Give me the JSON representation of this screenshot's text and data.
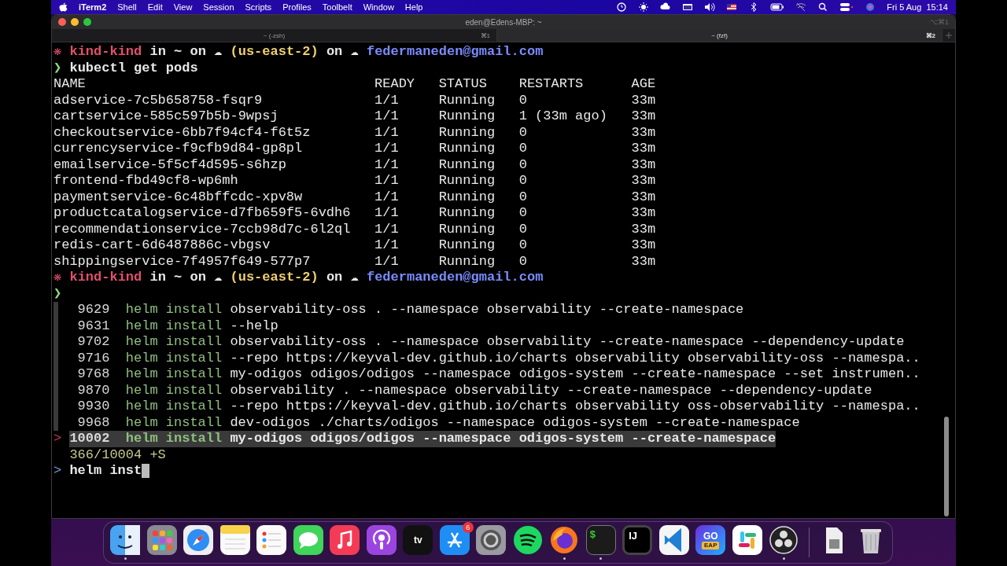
{
  "menu_bar": {
    "app": "iTerm2",
    "menus": [
      "Shell",
      "Edit",
      "View",
      "Session",
      "Scripts",
      "Profiles",
      "Toolbelt",
      "Window",
      "Help"
    ],
    "clock": "Fri 5 Aug  15:14"
  },
  "window": {
    "title": "eden@Edens-MBP: ~",
    "shortcut": "⌥⌘1",
    "tabs": [
      {
        "label": "~ (-zsh)",
        "shortcut": "⌘1",
        "selected": false
      },
      {
        "label": "~ (fzf)",
        "shortcut": "⌘2",
        "selected": true
      }
    ]
  },
  "terminal": {
    "lines": [
      {
        "kind": "prompt",
        "marker": "❋",
        "context": "kind-kind",
        "before": "in ~ on ☁",
        "region": "(us-east-2)",
        "after": "on ☁",
        "account": "federmaneden@gmail.com"
      },
      {
        "kind": "command",
        "arrow": "❯",
        "text": "kubectl get pods"
      },
      {
        "kind": "table",
        "columns": [
          "NAME",
          "READY",
          "STATUS",
          "RESTARTS",
          "AGE"
        ],
        "rows": [
          [
            "adservice-7c5b658758-fsqr9",
            "1/1",
            "Running",
            "0",
            "33m"
          ],
          [
            "cartservice-585c597b5b-9wpsj",
            "1/1",
            "Running",
            "1 (33m ago)",
            "33m"
          ],
          [
            "checkoutservice-6bb7f94cf4-f6t5z",
            "1/1",
            "Running",
            "0",
            "33m"
          ],
          [
            "currencyservice-f9cfb9d84-gp8pl",
            "1/1",
            "Running",
            "0",
            "33m"
          ],
          [
            "emailservice-5f5cf4d595-s6hzp",
            "1/1",
            "Running",
            "0",
            "33m"
          ],
          [
            "frontend-fbd49cf8-wp6mh",
            "1/1",
            "Running",
            "0",
            "33m"
          ],
          [
            "paymentservice-6c48bffcdc-xpv8w",
            "1/1",
            "Running",
            "0",
            "33m"
          ],
          [
            "productcatalogservice-d7fb659f5-6vdh6",
            "1/1",
            "Running",
            "0",
            "33m"
          ],
          [
            "recommendationservice-7ccb98d7c-6l2ql",
            "1/1",
            "Running",
            "0",
            "33m"
          ],
          [
            "redis-cart-6d6487886c-vbgsv",
            "1/1",
            "Running",
            "0",
            "33m"
          ],
          [
            "shippingservice-7f4957f649-577p7",
            "1/1",
            "Running",
            "0",
            "33m"
          ]
        ]
      },
      {
        "kind": "prompt",
        "marker": "❋",
        "context": "kind-kind",
        "before": "in ~ on ☁",
        "region": "(us-east-2)",
        "after": "on ☁",
        "account": "federmaneden@gmail.com"
      },
      {
        "kind": "command",
        "arrow": "❯"
      }
    ],
    "history": {
      "marker": ">",
      "items": [
        {
          "number": "9629",
          "command": "helm install",
          "args": "observability-oss . --namespace observability --create-namespace",
          "selected": false
        },
        {
          "number": "9631",
          "command": "helm install",
          "args": "--help",
          "selected": false
        },
        {
          "number": "9702",
          "command": "helm install",
          "args": "observability-oss . --namespace observability --create-namespace --dependency-update",
          "selected": false
        },
        {
          "number": "9716",
          "command": "helm install",
          "args": "--repo https://keyval-dev.github.io/charts observability observability-oss --namespa..",
          "selected": false
        },
        {
          "number": "9768",
          "command": "helm install",
          "args": "my-odigos odigos/odigos --namespace odigos-system --create-namespace --set instrumen..",
          "selected": false
        },
        {
          "number": "9870",
          "command": "helm install",
          "args": "observability . --namespace observability --create-namespace --dependency-update",
          "selected": false
        },
        {
          "number": "9930",
          "command": "helm install",
          "args": "--repo https://keyval-dev.github.io/charts observability oss-observability --namespa..",
          "selected": false
        },
        {
          "number": "9968",
          "command": "helm install",
          "args": "dev-odigos ./charts/odigos --namespace odigos-system --create-namespace",
          "selected": false
        },
        {
          "number": "10002",
          "command": "helm install",
          "args": "my-odigos odigos/odigos --namespace odigos-system --create-namespace",
          "selected": true
        }
      ],
      "count": "366/10004 +S",
      "prompt": ">",
      "query": "helm inst"
    }
  },
  "dock": {
    "items": [
      {
        "kind": "finder",
        "running": true
      },
      {
        "kind": "launchpad",
        "running": false
      },
      {
        "kind": "safari",
        "running": false
      },
      {
        "kind": "notes",
        "running": false
      },
      {
        "kind": "reminders",
        "running": false
      },
      {
        "kind": "messages",
        "running": false
      },
      {
        "kind": "music",
        "running": false
      },
      {
        "kind": "podcasts",
        "running": false
      },
      {
        "kind": "tv",
        "running": false,
        "label": "tv"
      },
      {
        "kind": "appstore",
        "running": false,
        "badge": "6"
      },
      {
        "kind": "settings",
        "running": false
      },
      {
        "kind": "spotify",
        "running": false
      },
      {
        "kind": "firefox",
        "running": true
      },
      {
        "kind": "terminal",
        "running": true,
        "label": "$"
      },
      {
        "kind": "intellij",
        "running": false,
        "label": "IJ"
      },
      {
        "kind": "vscode",
        "running": false
      },
      {
        "kind": "goland",
        "running": false,
        "label": "GO",
        "sublabel": "EAP"
      },
      {
        "kind": "slack",
        "running": false
      },
      {
        "kind": "obs",
        "running": true
      }
    ],
    "trailing": [
      {
        "kind": "file",
        "running": false
      },
      {
        "kind": "trash",
        "running": false
      }
    ]
  }
}
